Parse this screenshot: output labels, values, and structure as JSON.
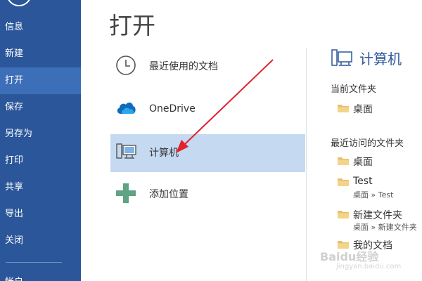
{
  "sidebar": {
    "items": [
      {
        "label": "信息"
      },
      {
        "label": "新建"
      },
      {
        "label": "打开"
      },
      {
        "label": "保存"
      },
      {
        "label": "另存为"
      },
      {
        "label": "打印"
      },
      {
        "label": "共享"
      },
      {
        "label": "导出"
      },
      {
        "label": "关闭"
      }
    ],
    "partial_label": "帐户",
    "accent": "#2b579a",
    "active_color": "#3d6fb8"
  },
  "main": {
    "title": "打开",
    "locations": [
      {
        "label": "最近使用的文档",
        "icon": "clock-icon"
      },
      {
        "label": "OneDrive",
        "icon": "cloud-icon"
      },
      {
        "label": "计算机",
        "icon": "computer-icon",
        "selected": true
      },
      {
        "label": "添加位置",
        "icon": "plus-icon"
      }
    ],
    "selected_color": "#c5d9f1"
  },
  "right_panel": {
    "title": "计算机",
    "current_folder_heading": "当前文件夹",
    "current_folder": {
      "name": "桌面"
    },
    "recent_heading": "最近访问的文件夹",
    "recent_folders": [
      {
        "name": "桌面",
        "path": ""
      },
      {
        "name": "Test",
        "path": "桌面 » Test"
      },
      {
        "name": "新建文件夹",
        "path": "桌面 » 新建文件夹"
      },
      {
        "name": "我的文档",
        "path": ""
      }
    ]
  },
  "watermark": {
    "text": "Baidu经验",
    "sub": "jingyan.baidu.com"
  }
}
